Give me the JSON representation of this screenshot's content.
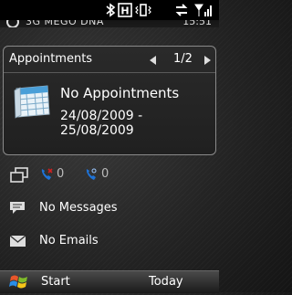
{
  "status_bar": {
    "icons": [
      "bluetooth-icon",
      "hsdpa-icon",
      "vibrate-icon",
      "data-connection-icon",
      "signal-strength-icon"
    ],
    "network_letter": "H"
  },
  "header": {
    "carrier": "3G MEGO DNA",
    "time": "15:51"
  },
  "appointments": {
    "title": "Appointments",
    "page": "1/2",
    "status": "No Appointments",
    "range": "24/08/2009 - 25/08/2009"
  },
  "calls": {
    "missed_count": "0",
    "voicemail_count": "0"
  },
  "messages": {
    "label": "No Messages"
  },
  "emails": {
    "label": "No Emails"
  },
  "bottom_bar": {
    "start_label": "Start",
    "right_softkey": "Today"
  },
  "colors": {
    "accent_blue": "#1e73d8",
    "background": "#232323"
  }
}
